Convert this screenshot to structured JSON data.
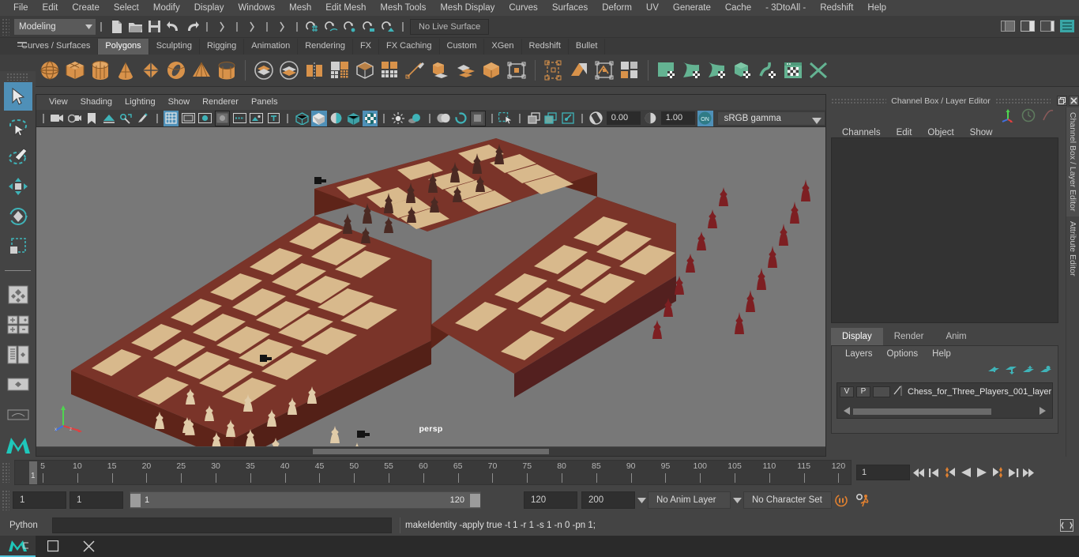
{
  "menubar": {
    "items": [
      "File",
      "Edit",
      "Create",
      "Select",
      "Modify",
      "Display",
      "Windows",
      "Mesh",
      "Edit Mesh",
      "Mesh Tools",
      "Mesh Display",
      "Curves",
      "Surfaces",
      "Deform",
      "UV",
      "Generate",
      "Cache",
      "- 3DtoAll -",
      "Redshift",
      "Help"
    ]
  },
  "statusline": {
    "menuset": "Modeling",
    "live_surface": "No Live Surface",
    "icons": [
      "new-scene-icon",
      "open-scene-icon",
      "save-scene-icon",
      "undo-icon",
      "redo-icon",
      "select-by-hierarchy-icon",
      "select-by-object-icon",
      "select-by-component-icon",
      "snap-grid-icon",
      "snap-curve-icon",
      "snap-point-icon",
      "snap-projected-icon",
      "snap-view-plane-icon",
      "construction-history-icon",
      "render-icon",
      "ipr-render-icon",
      "render-settings-icon",
      "sidebar-toggle-icon",
      "channelbox-toggle-icon",
      "attribute-editor-toggle-icon",
      "tool-settings-toggle-icon"
    ]
  },
  "shelf": {
    "tabs": [
      "Curves / Surfaces",
      "Polygons",
      "Sculpting",
      "Rigging",
      "Animation",
      "Rendering",
      "FX",
      "FX Caching",
      "Custom",
      "XGen",
      "Redshift",
      "Bullet"
    ],
    "active_tab": "Polygons",
    "icons": [
      "poly-sphere-icon",
      "poly-cube-icon",
      "poly-cylinder-icon",
      "poly-cone-icon",
      "poly-plane-icon",
      "poly-torus-icon",
      "poly-pyramid-icon",
      "poly-pipe-icon",
      "combine-icon",
      "separate-icon",
      "booleans-icon",
      "smooth-icon",
      "mirror-icon",
      "quad-draw-icon",
      "multi-cut-icon",
      "extrude-icon",
      "bevel-icon",
      "bridge-icon",
      "target-weld-icon",
      "sculpt-icon",
      "create-uvs-icon",
      "planar-map-icon",
      "uv-editor-icon",
      "uv-layout-icon",
      "uv-snapshot-icon",
      "poly-paint-icon",
      "unfold-icon",
      "cut-uv-icon",
      "sew-uv-icon",
      "uv-checker-icon",
      "symmetry-icon"
    ]
  },
  "toolbox": {
    "items": [
      "select-tool",
      "lasso-select-tool",
      "paint-select-tool",
      "move-tool",
      "rotate-tool",
      "scale-tool",
      "last-tool-used",
      "single-perspective-layout",
      "four-view-layout",
      "persp-outliner-layout",
      "persp-graph-layout",
      "hypershade-layout",
      "maya-logo"
    ]
  },
  "viewport": {
    "menus": [
      "View",
      "Shading",
      "Lighting",
      "Show",
      "Renderer",
      "Panels"
    ],
    "exposure": "0.00",
    "gamma": "1.00",
    "color_management": "sRGB gamma",
    "camera_label": "persp",
    "icons": [
      "select-camera-icon",
      "camera-attributes-icon",
      "bookmark-icon",
      "image-plane-icon",
      "2d-pan-zoom-icon",
      "grease-pencil-icon",
      "grid-icon",
      "film-gate-icon",
      "resolution-gate-icon",
      "gate-mask-icon",
      "field-chart-icon",
      "safe-action-icon",
      "safe-title-icon",
      "wireframe-icon",
      "smooth-shade-icon",
      "flat-shade-icon",
      "wireframe-on-shaded-icon",
      "textured-icon",
      "lights-icon",
      "shadows-icon",
      "screen-space-ao-icon",
      "motion-blur-icon",
      "multisample-icon",
      "depth-of-field-icon",
      "isolate-select-icon",
      "xray-icon",
      "xray-joints-icon",
      "xray-active-icon",
      "exposure-icon",
      "gamma-icon",
      "color-management-toggle-icon"
    ]
  },
  "channelbox": {
    "title": "Channel Box / Layer Editor",
    "menus": [
      "Channels",
      "Edit",
      "Object",
      "Show"
    ],
    "vertical_tabs": [
      "Channel Box / Layer Editor",
      "Attribute Editor"
    ],
    "layer_tabs": [
      "Display",
      "Render",
      "Anim"
    ],
    "active_layer_tab": "Display",
    "layer_menus": [
      "Layers",
      "Options",
      "Help"
    ],
    "layers": [
      {
        "visibility": "V",
        "playback": "P",
        "shading": "",
        "name": "Chess_for_Three_Players_001_layer"
      }
    ],
    "layer_icons": [
      "move-layer-up-icon",
      "move-layer-down-icon",
      "new-layer-icon",
      "new-layer-from-selected-icon"
    ],
    "window_buttons": [
      "restore-window-icon",
      "close-window-icon"
    ]
  },
  "timeslider": {
    "ticks": [
      5,
      10,
      15,
      20,
      25,
      30,
      35,
      40,
      45,
      50,
      55,
      60,
      65,
      70,
      75,
      80,
      85,
      90,
      95,
      100,
      105,
      110,
      115,
      120
    ],
    "current_frame": "1",
    "current_frame_field": "1",
    "playback_buttons": [
      "go-to-start-icon",
      "step-back-frame-icon",
      "step-back-key-icon",
      "play-backwards-icon",
      "play-forwards-icon",
      "step-forward-key-icon",
      "step-forward-frame-icon",
      "go-to-end-icon"
    ]
  },
  "rangeslider": {
    "anim_start": "1",
    "playback_start": "1",
    "range_low": "1",
    "range_high": "120",
    "playback_end": "120",
    "anim_end": "200",
    "anim_layer": "No Anim Layer",
    "character_set": "No Character Set",
    "icons": [
      "auto-key-icon",
      "animation-preferences-icon"
    ]
  },
  "commandline": {
    "language": "Python",
    "input_value": "",
    "output": "makeIdentity -apply true -t 1 -r 1 -s 1 -n 0 -pn 1;",
    "icon": "script-editor-icon"
  },
  "taskbar": {
    "items": [
      "maya-app-icon",
      "window-icon",
      "close-icon"
    ]
  },
  "colors": {
    "accent_blue": "#4f90b8",
    "accent_teal": "#3fb3b8",
    "shelf_orange": "#d8924a",
    "shelf_green": "#6dbb93",
    "bg_panel": "#444444",
    "bg_dark": "#2f2f2f",
    "viewport_bg": "#787878",
    "board_dark": "#7a3429",
    "board_light": "#d8b98c",
    "piece_white": "#e0cba8",
    "piece_red": "#7d1f22",
    "piece_dark": "#5a2f28",
    "orange_playhead": "#e08030"
  }
}
